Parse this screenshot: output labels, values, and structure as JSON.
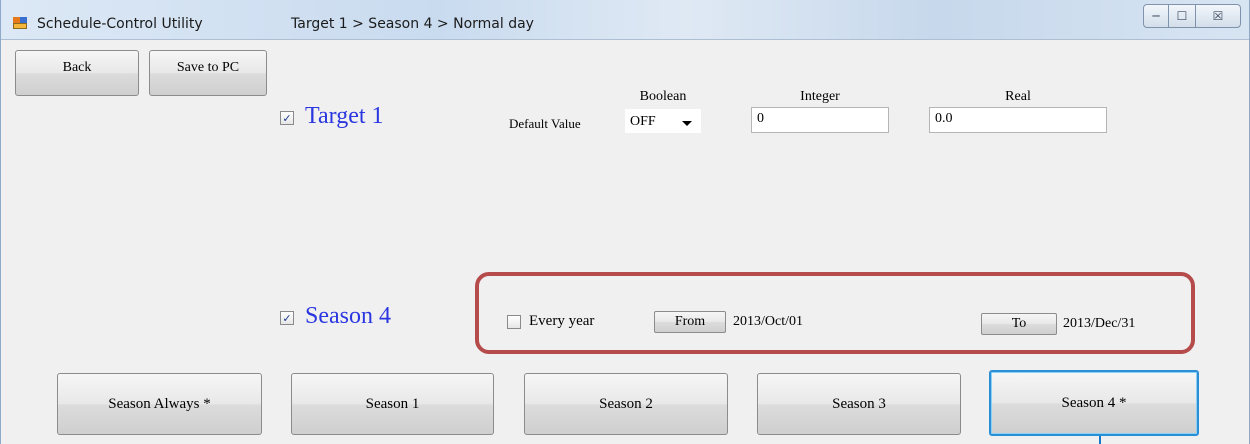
{
  "window": {
    "title": "Schedule-Control Utility",
    "breadcrumb": "Target 1 > Season 4 > Normal day",
    "controls": {
      "minimize": "─",
      "maximize": "☐",
      "close": "☒"
    }
  },
  "toolbar": {
    "back_label": "Back",
    "save_label": "Save to PC"
  },
  "target": {
    "checked": true,
    "label": "Target 1",
    "default_value_label": "Default Value",
    "boolean": {
      "header": "Boolean",
      "value": "OFF"
    },
    "integer": {
      "header": "Integer",
      "value": "0"
    },
    "real": {
      "header": "Real",
      "value": "0.0"
    }
  },
  "season": {
    "checked": true,
    "label": "Season 4",
    "every_year_label": "Every year",
    "every_year_checked": false,
    "from_label": "From",
    "from_date": "2013/Oct/01",
    "to_label": "To",
    "to_date": "2013/Dec/31"
  },
  "season_buttons": [
    {
      "label": "Season Always *",
      "selected": false
    },
    {
      "label": "Season 1",
      "selected": false
    },
    {
      "label": "Season 2",
      "selected": false
    },
    {
      "label": "Season 3",
      "selected": false
    },
    {
      "label": "Season 4 *",
      "selected": true
    }
  ],
  "colors": {
    "accent_label": "#2a36e0",
    "highlight_border": "#b54b4b",
    "selected_border": "#2b8fd8"
  },
  "icons": {
    "app": "app-icon",
    "checkbox_checked": "✓"
  }
}
